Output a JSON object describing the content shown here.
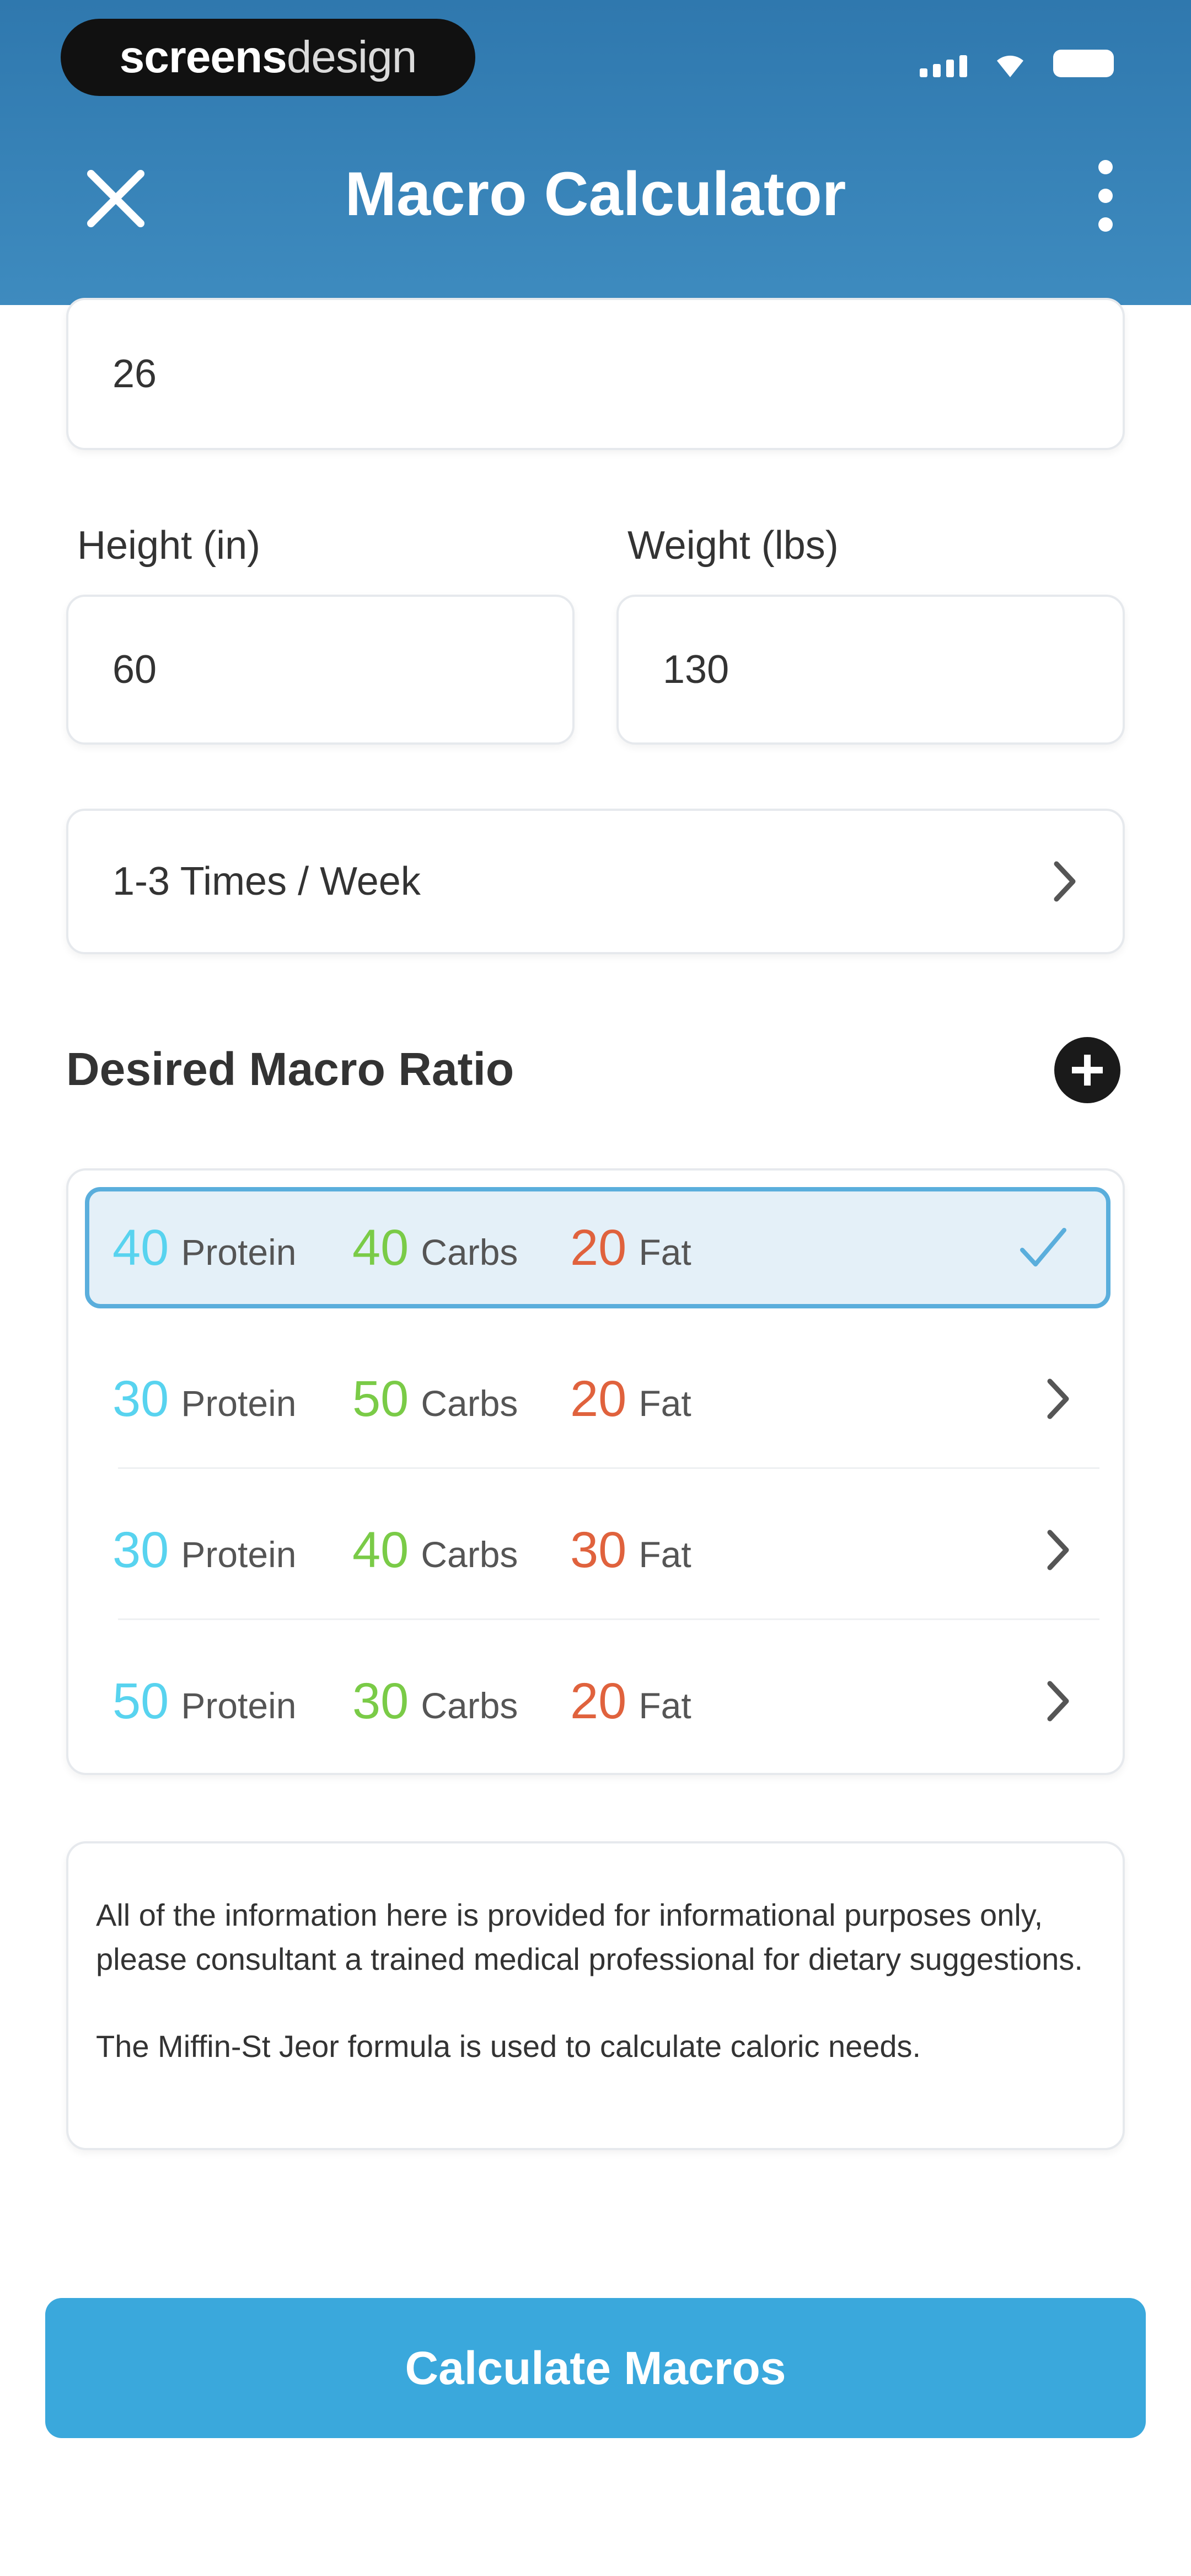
{
  "status_bar": {
    "badge_bold": "screens",
    "badge_light": "design"
  },
  "header": {
    "title": "Macro Calculator",
    "close_icon": "close-icon",
    "more_icon": "more-vertical-icon"
  },
  "form": {
    "age_value": "26",
    "height_label": "Height (in)",
    "height_value": "60",
    "weight_label": "Weight (lbs)",
    "weight_value": "130",
    "activity_value": "1-3 Times / Week"
  },
  "macro_section": {
    "title": "Desired Macro Ratio",
    "add_icon": "add-circle-icon",
    "options": [
      {
        "protein": "40",
        "protein_label": "Protein",
        "carbs": "40",
        "carbs_label": "Carbs",
        "fat": "20",
        "fat_label": "Fat",
        "selected": true
      },
      {
        "protein": "30",
        "protein_label": "Protein",
        "carbs": "50",
        "carbs_label": "Carbs",
        "fat": "20",
        "fat_label": "Fat",
        "selected": false
      },
      {
        "protein": "30",
        "protein_label": "Protein",
        "carbs": "40",
        "carbs_label": "Carbs",
        "fat": "30",
        "fat_label": "Fat",
        "selected": false
      },
      {
        "protein": "50",
        "protein_label": "Protein",
        "carbs": "30",
        "carbs_label": "Carbs",
        "fat": "20",
        "fat_label": "Fat",
        "selected": false
      }
    ]
  },
  "disclaimer": {
    "line1": "All of the information here is provided for informational purposes only, please consultant a trained medical professional for dietary suggestions.",
    "line2": "The Miffin-St Jeor formula is used to calculate caloric needs."
  },
  "actions": {
    "calculate_label": "Calculate Macros"
  },
  "colors": {
    "header": "#2f78ae",
    "protein": "#58d3ef",
    "carbs": "#7acb47",
    "fat": "#e0623d",
    "button": "#3aa8dc",
    "selected_border": "#5aaedc"
  }
}
